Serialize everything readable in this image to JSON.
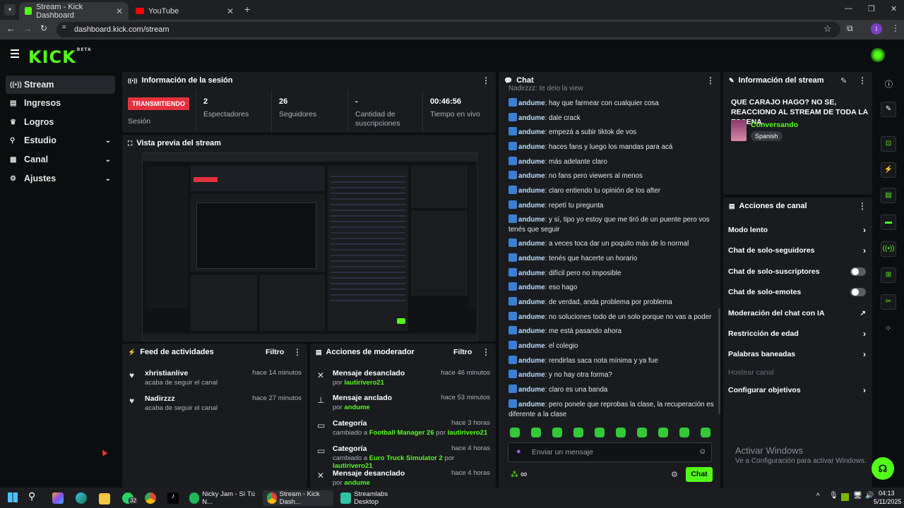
{
  "browser": {
    "tabs": [
      {
        "label": "Stream - Kick Dashboard"
      },
      {
        "label": "YouTube"
      }
    ],
    "url": "dashboard.kick.com/stream",
    "profile_initial": "I"
  },
  "kick": {
    "logo": "KICK",
    "logo_tag": "BETA"
  },
  "sidebar": {
    "items": [
      {
        "label": "Stream",
        "icon": "broadcast-icon"
      },
      {
        "label": "Ingresos",
        "icon": "revenue-icon"
      },
      {
        "label": "Logros",
        "icon": "trophy-icon"
      },
      {
        "label": "Estudio",
        "icon": "studio-icon"
      },
      {
        "label": "Canal",
        "icon": "channel-icon"
      },
      {
        "label": "Ajustes",
        "icon": "gear-icon"
      }
    ]
  },
  "session": {
    "title": "Información de la sesión",
    "status": "TRANSMITIENDO",
    "status_label": "Sesión",
    "stats": [
      {
        "value": "2",
        "label": "Espectadores"
      },
      {
        "value": "26",
        "label": "Seguidores"
      },
      {
        "value": "-",
        "label": "Cantidad de suscripciones"
      },
      {
        "value": "00:46:56",
        "label": "Tiempo en vivo"
      }
    ]
  },
  "preview": {
    "title": "Vista previa del stream"
  },
  "feed": {
    "title": "Feed de actividades",
    "filter": "Filtro",
    "items": [
      {
        "name": "xhristianlive",
        "text": "acaba de seguir el canal",
        "time": "hace 14 minutos"
      },
      {
        "name": "Nadirzzz",
        "text": "acaba de seguir el canal",
        "time": "hace 27 minutos"
      }
    ]
  },
  "mod": {
    "title": "Acciones de moderador",
    "filter": "Filtro",
    "items": [
      {
        "title": "Mensaje desanclado",
        "pre": "por",
        "user": "lautirivero21",
        "time": "hace 46 minutos"
      },
      {
        "title": "Mensaje anclado",
        "pre": "por",
        "user": "andume",
        "time": "hace 53 minutos"
      },
      {
        "title": "Categoría",
        "pre": "cambiado a",
        "game": "Football Manager 26",
        "by": "por",
        "user": "lautirivero21",
        "time": "hace 3 horas"
      },
      {
        "title": "Categoría",
        "pre": "cambiado a",
        "game": "Euro Truck Simulator 2",
        "by": "por",
        "user": "lautirivero21",
        "time": "hace 4 horas"
      },
      {
        "title": "Mensaje desanclado",
        "pre": "por",
        "user": "andume",
        "time": "hace 4 horas"
      }
    ]
  },
  "chat": {
    "title": "Chat",
    "top_partial": "Nadirzzz: te dejo la view",
    "messages": [
      {
        "user": "andume",
        "text": "hay que farmear con cualquier cosa"
      },
      {
        "user": "andume",
        "text": "dale crack"
      },
      {
        "user": "andume",
        "text": "empezá a subir tiktok de vos"
      },
      {
        "user": "andume",
        "text": "haces fans y luego los mandas para acá"
      },
      {
        "user": "andume",
        "text": "más adelante claro"
      },
      {
        "user": "andume",
        "text": "no fans pero viewers al menos"
      },
      {
        "user": "andume",
        "text": "claro entiendo tu opinión de los after"
      },
      {
        "user": "andume",
        "text": "repetí tu pregunta"
      },
      {
        "user": "andume",
        "text": "y sí, tipo yo estoy que me tiró de un puente pero vos tenés que seguir"
      },
      {
        "user": "andume",
        "text": "a veces toca dar un poquito más de lo normal"
      },
      {
        "user": "andume",
        "text": "tenés que hacerte un horario"
      },
      {
        "user": "andume",
        "text": "difícil pero no imposible"
      },
      {
        "user": "andume",
        "text": "eso hago"
      },
      {
        "user": "andume",
        "text": "de verdad, anda problema por problema"
      },
      {
        "user": "andume",
        "text": "no soluciones todo de un solo porque no vas a poder"
      },
      {
        "user": "andume",
        "text": "me está pasando ahora"
      },
      {
        "user": "andume",
        "text": "el colegio"
      },
      {
        "user": "andume",
        "text": "rendirlas saca nota mínima y ya fue"
      },
      {
        "user": "andume",
        "text": "y no hay otra forma?"
      },
      {
        "user": "andume",
        "text": "claro es una banda"
      },
      {
        "user": "andume",
        "text": "pero ponele que reprobas la clase, la recuperación es diferente a la clase"
      }
    ],
    "input_placeholder": "Enviar un mensaje",
    "send_label": "Chat",
    "points": "∞"
  },
  "stream_info": {
    "title": "Información del stream",
    "stream_title": "QUE CARAJO HAGO? NO SE, REACCIONO AL STREAM DE TODA LA ESCENA.",
    "category": "Conversando",
    "language": "Spanish"
  },
  "channel_actions": {
    "title": "Acciones de canal",
    "items": [
      {
        "label": "Modo lento",
        "control": "chevron"
      },
      {
        "label": "Chat de solo-seguidores",
        "control": "chevron"
      },
      {
        "label": "Chat de solo-suscriptores",
        "control": "toggle"
      },
      {
        "label": "Chat de solo-emotes",
        "control": "toggle"
      },
      {
        "label": "Moderación del chat con IA",
        "control": "external"
      },
      {
        "label": "Restricción de edad",
        "control": "chevron"
      },
      {
        "label": "Palabras baneadas",
        "control": "chevron"
      },
      {
        "label": "Hostear canal",
        "control": "none"
      },
      {
        "label": "Configurar objetivos",
        "control": "chevron"
      }
    ]
  },
  "windows_watermark": {
    "title": "Activar Windows",
    "subtitle": "Ve a Configuración para activar Windows."
  },
  "taskbar": {
    "whatsapp_badge": "32",
    "apps": [
      {
        "label": "Nicky Jam - Sí Tú N..."
      },
      {
        "label": "Stream - Kick Dash..."
      },
      {
        "label": "Streamlabs Desktop"
      }
    ],
    "time": "04:13",
    "date": "5/11/2025"
  },
  "colors": {
    "accent": "#53fc18",
    "live": "#e5313f",
    "panel": "#191b1f",
    "bg": "#0b0e0f"
  }
}
